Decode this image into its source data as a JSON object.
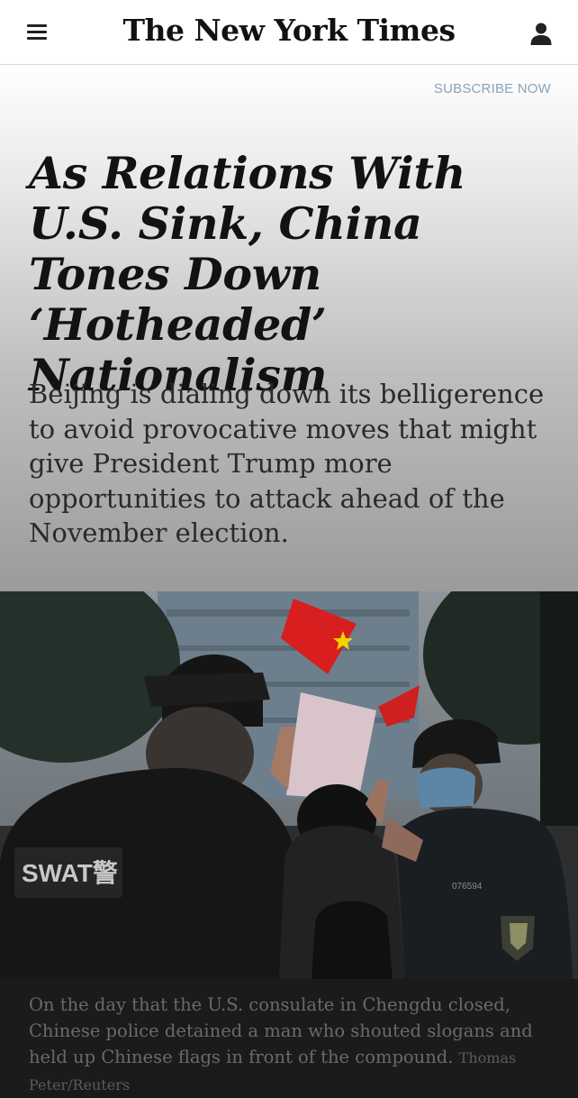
{
  "header": {
    "logo": "The New York Times",
    "menu_icon": "hamburger-menu-icon",
    "account_icon": "user-account-icon"
  },
  "hero": {
    "subscribe_label": "SUBSCRIBE NOW",
    "headline": "As Relations With U.S. Sink, China Tones Down ‘Hotheaded’ Nationalism",
    "summary": "Beijing is dialing down its belligerence to avoid provocative moves that might give President Trump more opportunities to attack ahead of the November election."
  },
  "photo": {
    "vest_text": "SWAT警",
    "badge_number": "076594"
  },
  "caption": {
    "text": "On the day that the U.S. consulate in Chengdu closed, Chinese police detained a man who shouted slogans and held up Chinese flags in front of the compound.",
    "credit": "Thomas Peter/Reuters"
  },
  "colors": {
    "subscribe": "#8aa3b8",
    "headline": "#121212",
    "caption_text": "#6a6a6a"
  }
}
